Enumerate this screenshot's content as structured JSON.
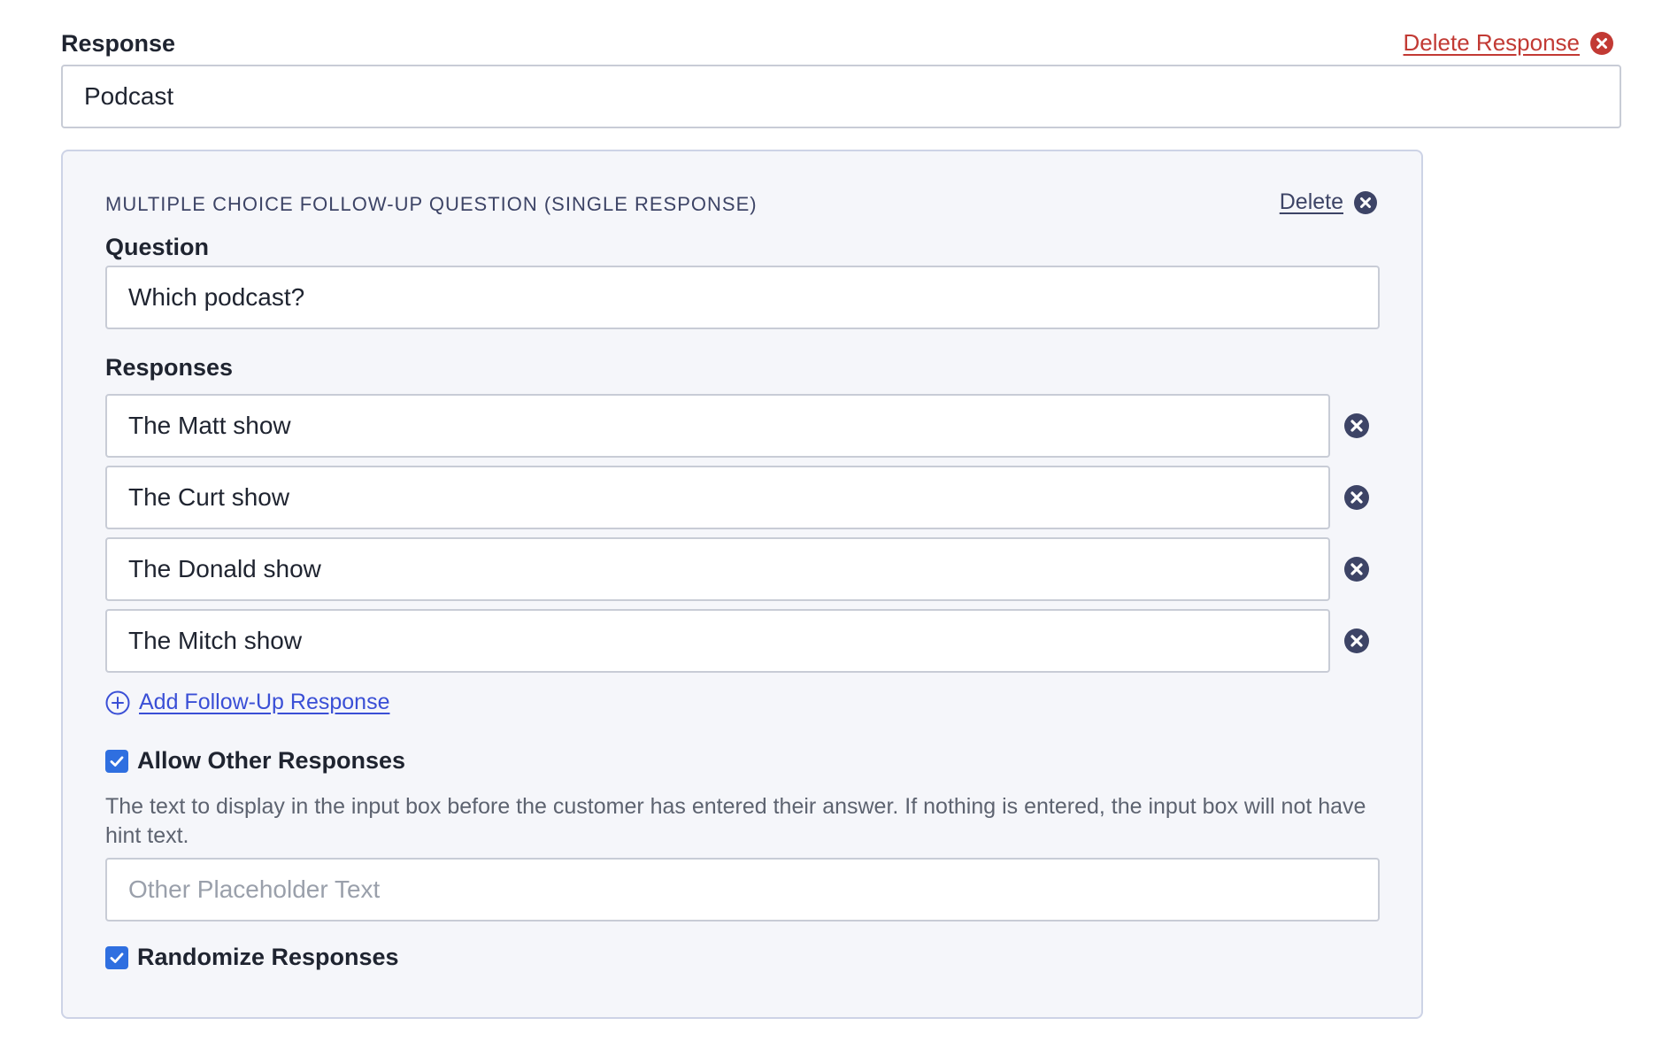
{
  "response": {
    "label": "Response",
    "value": "Podcast",
    "delete_label": "Delete Response"
  },
  "followup": {
    "heading": "MULTIPLE CHOICE FOLLOW-UP QUESTION (SINGLE RESPONSE)",
    "delete_label": "Delete",
    "question_label": "Question",
    "question_value": "Which podcast?",
    "responses_label": "Responses",
    "responses": [
      {
        "value": "The Matt show"
      },
      {
        "value": "The Curt show"
      },
      {
        "value": "The Donald show"
      },
      {
        "value": "The Mitch show"
      }
    ],
    "add_label": "Add Follow-Up Response",
    "allow_other": {
      "label": "Allow Other Responses",
      "checked": true
    },
    "help_text": "The text to display in the input box before the customer has entered their answer. If nothing is entered, the input box will not have hint text.",
    "other_placeholder": "Other Placeholder Text",
    "randomize": {
      "label": "Randomize Responses",
      "checked": true
    }
  },
  "colors": {
    "danger": "#c23a34",
    "accent": "#3a4fd6",
    "checkbox": "#2f6fe0",
    "icon_dark": "#3d4466"
  },
  "icons": {
    "delete_response": "close-circle-icon",
    "delete_panel": "close-circle-icon",
    "remove_response": "close-circle-icon",
    "add": "plus-circle-icon",
    "checkbox": "checkmark-icon"
  }
}
